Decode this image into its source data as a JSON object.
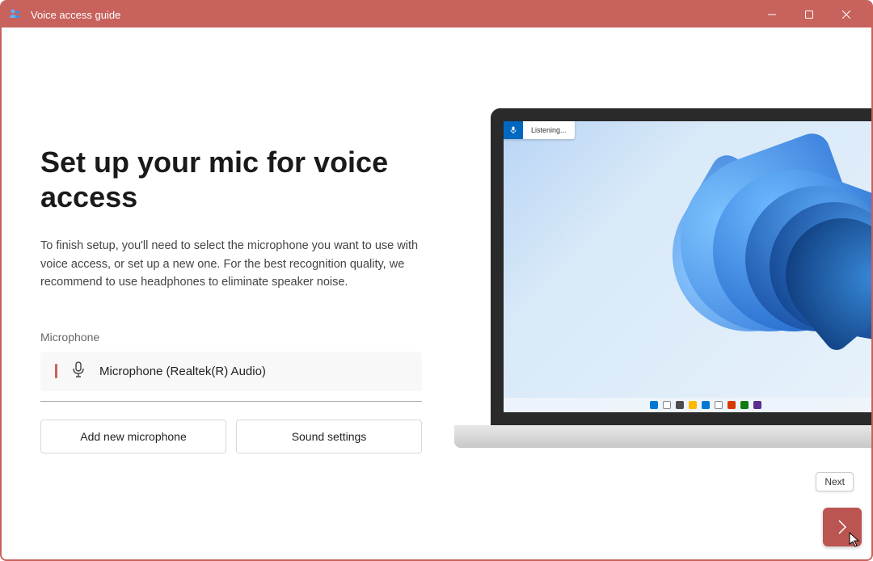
{
  "colors": {
    "accent": "#c8625d",
    "blue": "#0067c0"
  },
  "titlebar": {
    "title": "Voice access guide",
    "icon": "voice-access-icon"
  },
  "main": {
    "heading": "Set up your mic for voice access",
    "description": "To finish setup, you'll need to select the microphone you want to use with voice access, or set up a new one. For the best recognition quality, we recommend to use headphones to eliminate speaker noise.",
    "microphone_label": "Microphone",
    "selected_microphone": "Microphone (Realtek(R) Audio)",
    "add_button": "Add new microphone",
    "sound_settings_button": "Sound settings"
  },
  "preview": {
    "voice_status": "Listening..."
  },
  "footer": {
    "next_tooltip": "Next"
  }
}
